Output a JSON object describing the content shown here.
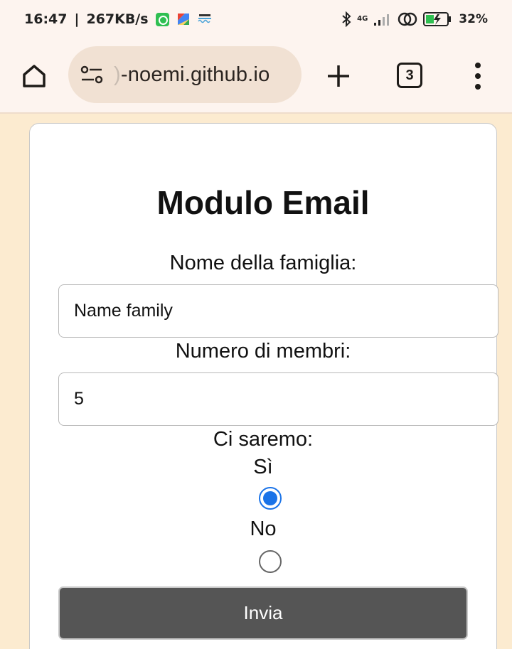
{
  "status_bar": {
    "time": "16:47",
    "speed": "267KB/s",
    "network": "4G",
    "battery": "32%",
    "app_icons": [
      "whatsapp-icon",
      "maps-icon",
      "app-icon"
    ],
    "system_icons": [
      "bluetooth-icon",
      "signal-icon",
      "hotspot-icon",
      "battery-icon"
    ]
  },
  "browser": {
    "url_faded": ")",
    "url": "-noemi.github.io",
    "tab_count": "3",
    "buttons": [
      "home-icon",
      "site-settings-icon",
      "new-tab-icon",
      "tabs-icon",
      "more-menu-icon"
    ]
  },
  "form": {
    "title": "Modulo Email",
    "family_label": "Nome della famiglia:",
    "family_value": "Name family",
    "members_label": "Numero di membri:",
    "members_value": "5",
    "attendance_label": "Ci saremo:",
    "option_yes": "Sì",
    "option_no": "No",
    "selected": "Sì",
    "submit_label": "Invia"
  },
  "colors": {
    "page_bg": "#fcebd0",
    "toolbar_bg": "#fdf4ef",
    "url_pill_bg": "#f1e1d3",
    "radio_accent": "#1a73e8",
    "button_bg": "#555555"
  }
}
